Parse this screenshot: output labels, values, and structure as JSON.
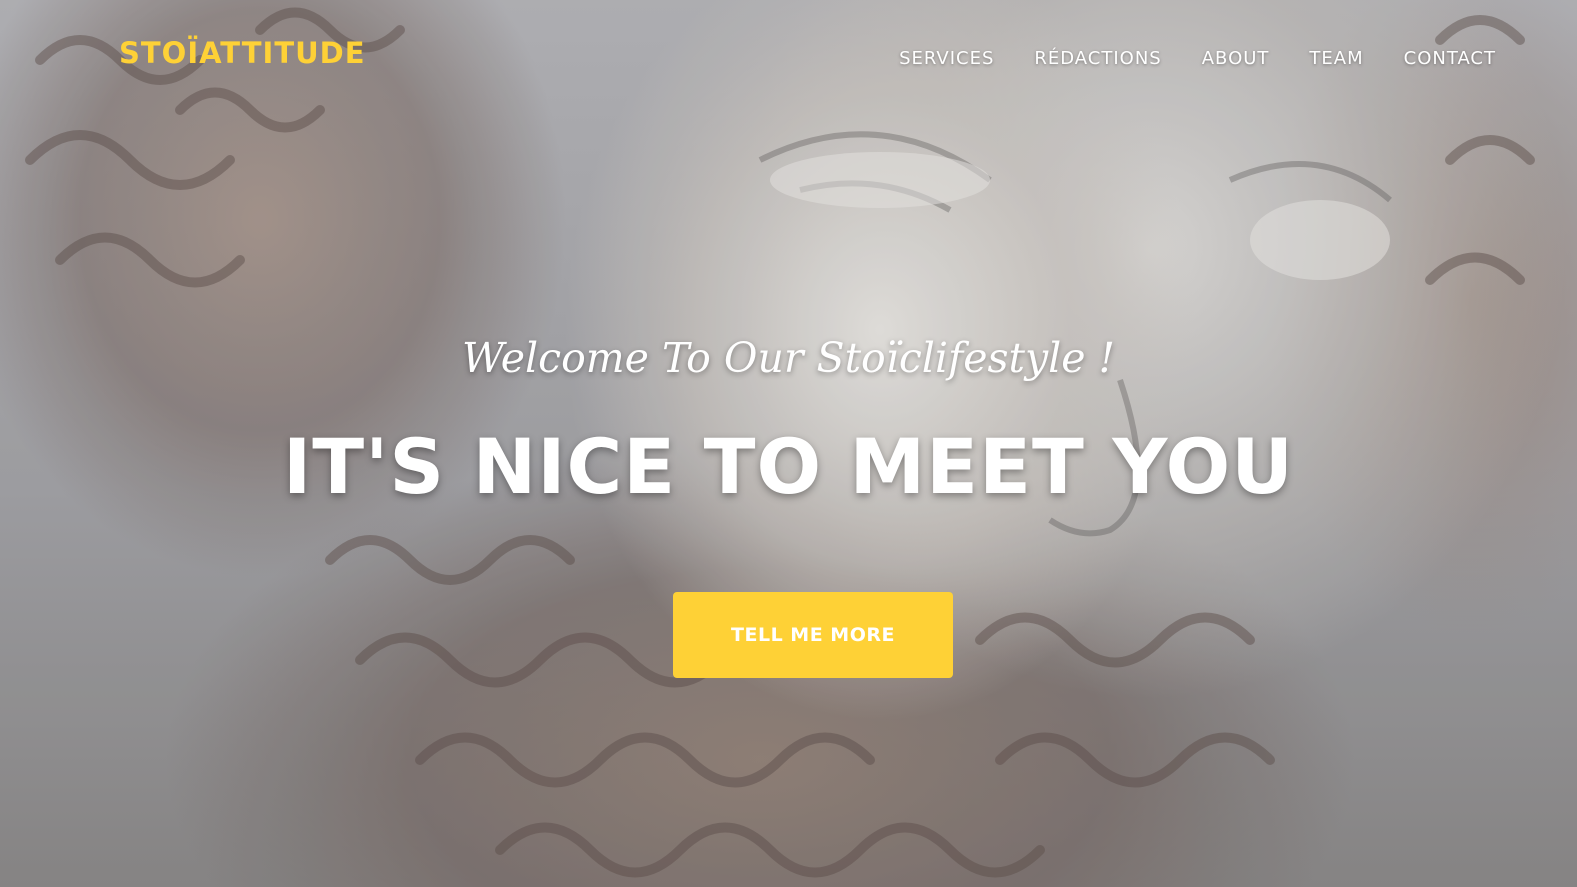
{
  "brand": {
    "name": "STOÏATTITUDE",
    "color": "#fed136"
  },
  "nav": {
    "items": [
      {
        "label": "SERVICES"
      },
      {
        "label": "RÉDACTIONS"
      },
      {
        "label": "ABOUT"
      },
      {
        "label": "TEAM"
      },
      {
        "label": "CONTACT"
      }
    ]
  },
  "hero": {
    "background_image": "marble-statue-head",
    "subheading": "Welcome To Our Stoïclifestyle !",
    "heading": "IT'S NICE TO MEET YOU",
    "cta_label": "TELL ME MORE",
    "cta_color": "#fed136"
  }
}
